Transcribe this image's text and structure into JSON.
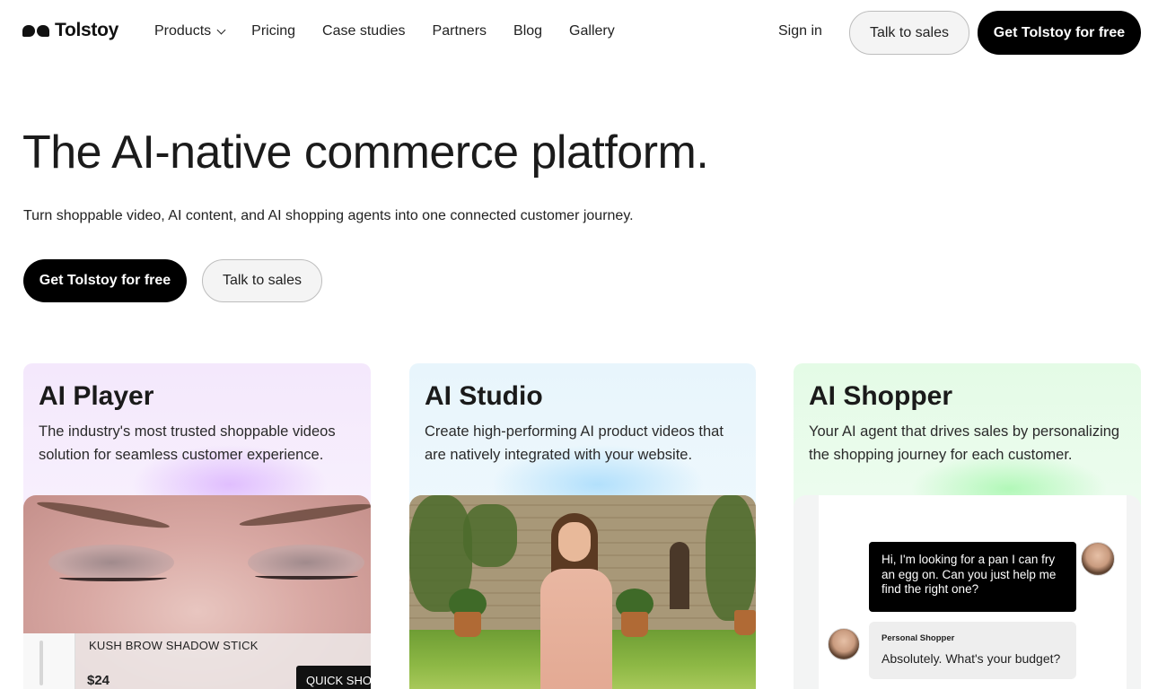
{
  "brand": {
    "name": "Tolstoy"
  },
  "nav": {
    "links": [
      "Products",
      "Pricing",
      "Case studies",
      "Partners",
      "Blog",
      "Gallery"
    ],
    "sign_in": "Sign in",
    "talk_to_sales": "Talk to sales",
    "get_free": "Get Tolstoy for free"
  },
  "hero": {
    "title": "The AI-native commerce platform.",
    "subtitle": "Turn shoppable video, AI content, and AI shopping agents into one connected customer journey.",
    "cta_primary": "Get Tolstoy for free",
    "cta_secondary": "Talk to sales"
  },
  "cards": [
    {
      "title": "AI Player",
      "description": "The industry's most trusted shoppable videos solution for seamless customer experience.",
      "product_name": "KUSH BROW SHADOW STICK",
      "product_price": "$24",
      "quick_shop": "QUICK SHOP"
    },
    {
      "title": "AI Studio",
      "description": "Create high-performing AI product videos that are natively integrated with your website."
    },
    {
      "title": "AI Shopper",
      "description": "Your AI agent that drives sales by personalizing the shopping journey for each customer.",
      "user_message": "Hi, I'm looking for a pan I can fry an egg on. Can you just help me find the right one?",
      "bot_label": "Personal Shopper",
      "bot_message": "Absolutely. What's your budget?"
    }
  ],
  "colors": {
    "primary_button": "#000000",
    "card_player_bg": "#f4e8fc",
    "card_studio_bg": "#e8f5fc",
    "card_shopper_bg": "#e4fbe6"
  },
  "icons": {
    "logo": "logo-icon",
    "products_dropdown": "chevron-down-icon"
  }
}
